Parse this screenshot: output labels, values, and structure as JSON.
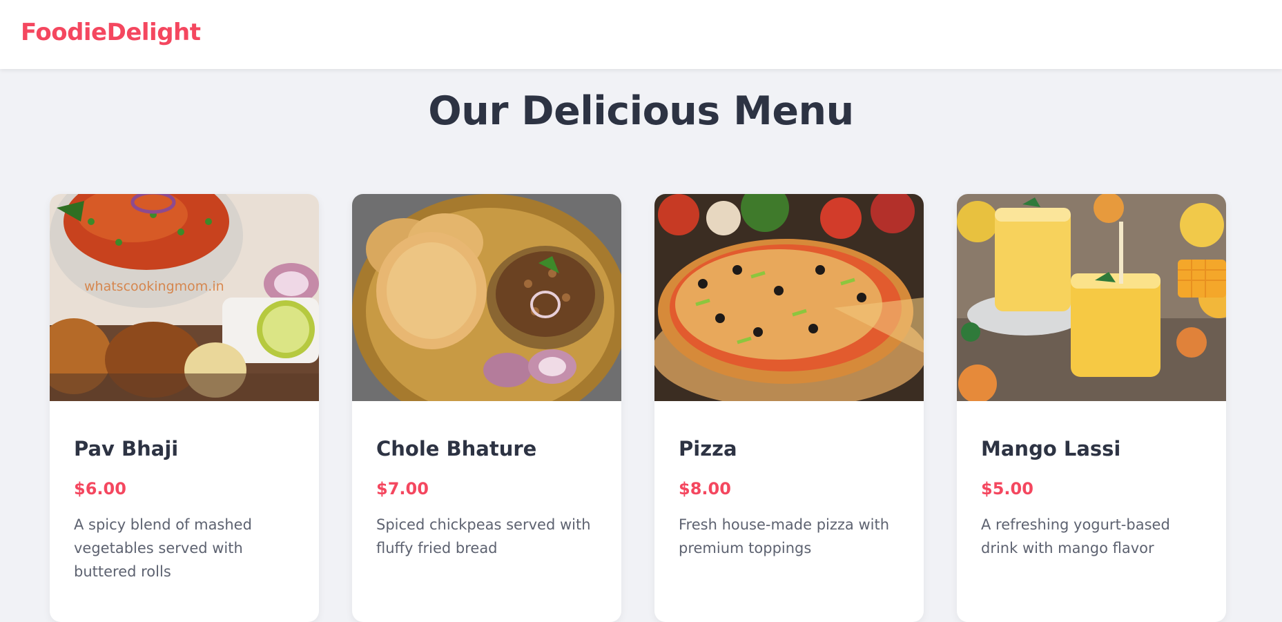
{
  "nav": {
    "brand": "FoodieDelight"
  },
  "page": {
    "title": "Our Delicious Menu"
  },
  "colors": {
    "brand": "#f4475f",
    "title": "#2d3343",
    "text": "#5d6270",
    "background": "#f1f2f6"
  },
  "menu": {
    "items": [
      {
        "name": "Pav Bhaji",
        "price": "$6.00",
        "description": "A spicy blend of mashed vegetables served with buttered rolls",
        "image_icon": "pav-bhaji-photo",
        "watermark": "whatscookingmom.in"
      },
      {
        "name": "Chole Bhature",
        "price": "$7.00",
        "description": "Spiced chickpeas served with fluffy fried bread",
        "image_icon": "chole-bhature-photo"
      },
      {
        "name": "Pizza",
        "price": "$8.00",
        "description": "Fresh house-made pizza with premium toppings",
        "image_icon": "pizza-photo"
      },
      {
        "name": "Mango Lassi",
        "price": "$5.00",
        "description": "A refreshing yogurt-based drink with mango flavor",
        "image_icon": "mango-lassi-photo"
      }
    ]
  }
}
